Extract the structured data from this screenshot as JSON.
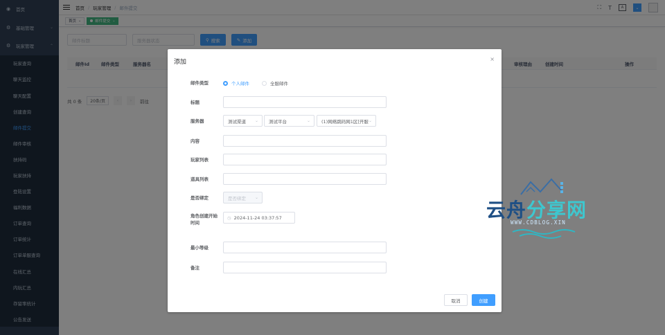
{
  "sidebar": {
    "groups": [
      {
        "label": "首页",
        "icon": "dashboard-icon",
        "arrow": ""
      },
      {
        "label": "基础管理",
        "icon": "settings-icon",
        "arrow": "⌄"
      },
      {
        "label": "玩家管理",
        "icon": "settings-icon",
        "arrow": "⌃"
      }
    ],
    "items": [
      {
        "label": "玩家查询",
        "active": false
      },
      {
        "label": "聊天监控",
        "active": false
      },
      {
        "label": "聊天配置",
        "active": false
      },
      {
        "label": "创建查询",
        "active": false
      },
      {
        "label": "邮件提交",
        "active": true
      },
      {
        "label": "邮件审核",
        "active": false
      },
      {
        "label": "扶持码",
        "active": false
      },
      {
        "label": "玩家扶持",
        "active": false
      },
      {
        "label": "登陆设置",
        "active": false
      },
      {
        "label": "福利数据",
        "active": false
      },
      {
        "label": "订单查询",
        "active": false
      },
      {
        "label": "订单统计",
        "active": false
      },
      {
        "label": "订单单服查询",
        "active": false
      },
      {
        "label": "在线汇总",
        "active": false
      },
      {
        "label": "内玩汇总",
        "active": false
      },
      {
        "label": "存留率统计",
        "active": false
      },
      {
        "label": "公告发送",
        "active": false
      }
    ]
  },
  "header": {
    "breadcrumbs": [
      "首页",
      "玩家管理",
      "邮件提交"
    ],
    "tools": {
      "font_label": "T",
      "lang_label": "A"
    }
  },
  "tags": {
    "home": "首页",
    "active": "邮件提交"
  },
  "filters": {
    "title_placeholder": "邮件标题",
    "status_placeholder": "服务器状态",
    "search_label": "搜索",
    "add_label": "添加"
  },
  "table": {
    "columns": [
      {
        "label": "邮件Id"
      },
      {
        "label": "邮件类型"
      },
      {
        "label": "服务器名"
      },
      {
        "label": "审核理由"
      },
      {
        "label": "创建时间"
      },
      {
        "label": "操作"
      }
    ]
  },
  "pager": {
    "total": "共 0 条",
    "page_size": "20条/页",
    "goto": "前往"
  },
  "dialog": {
    "title": "添加",
    "close": "×",
    "fields": {
      "mail_type": {
        "label": "邮件类型",
        "options": [
          "个人邮件",
          "全服邮件"
        ],
        "selected": "个人邮件"
      },
      "title": {
        "label": "标题",
        "value": ""
      },
      "server": {
        "label": "服务器",
        "channel": "测试渠道",
        "platform": "测试平台",
        "server": "(1)网络跳码网1区[开服"
      },
      "content": {
        "label": "内容",
        "value": ""
      },
      "players": {
        "label": "玩家列表",
        "value": ""
      },
      "items": {
        "label": "道具列表",
        "value": ""
      },
      "bind": {
        "label": "是否绑定",
        "placeholder": "是否绑定"
      },
      "role_time": {
        "label": "角色创建开始时间",
        "value": "2024-11-24 03:37:57"
      },
      "min_level": {
        "label": "最小等级",
        "value": ""
      },
      "remark": {
        "label": "备注",
        "value": ""
      }
    },
    "cancel_label": "取消",
    "confirm_label": "创建"
  },
  "watermark": {
    "text": "云舟分享网",
    "url": "WWW.CDBLOG.XIN"
  }
}
